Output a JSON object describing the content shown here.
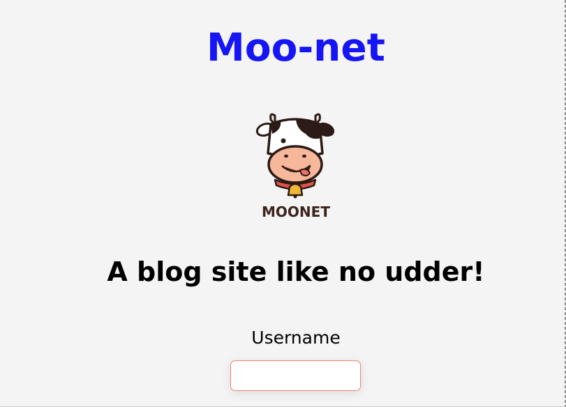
{
  "header": {
    "site_title": "Moo-net"
  },
  "logo": {
    "wordmark": "MOONET",
    "icon": "cow-mascot-icon",
    "brand_color": "#3c231b"
  },
  "main": {
    "tagline": "A blog site like no udder!"
  },
  "login_form": {
    "username_label": "Username",
    "username_value": "",
    "username_placeholder": ""
  },
  "colors": {
    "title": "#1515f5",
    "background": "#f4f4f4",
    "input_border": "#f0806c"
  }
}
